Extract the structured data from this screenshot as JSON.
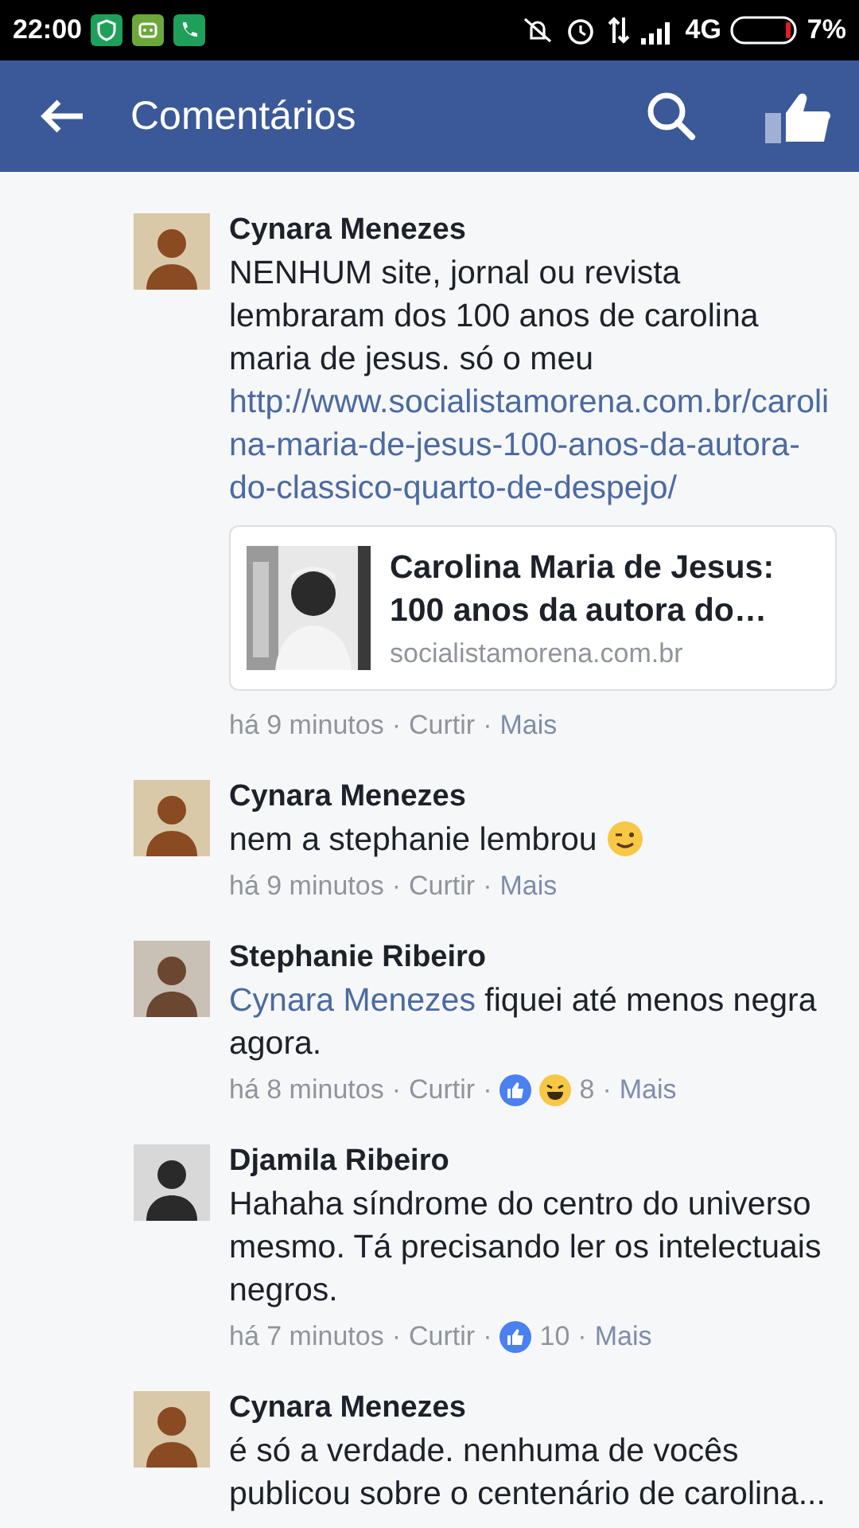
{
  "status_bar": {
    "time": "22:00",
    "network": "4G",
    "battery": "7%"
  },
  "header": {
    "title": "Comentários"
  },
  "comments": [
    {
      "author": "Cynara Menezes",
      "avatar": {
        "kind": "picture"
      },
      "body": [
        {
          "kind": "text",
          "text": "NENHUM site, jornal ou revista lembraram dos 100 anos de carolina maria de jesus. só o meu "
        },
        {
          "kind": "link",
          "text": "http://www.socialistamorena.com.br/carolina-maria-de-jesus-100-anos-da-autora-do-classico-quarto-de-despejo/"
        }
      ],
      "card": {
        "title": "Carolina Maria de Jesus: 100 anos da autora do…",
        "domain": "socialistamorena.com.br"
      },
      "meta": [
        {
          "kind": "time",
          "text": "há 9 minutos"
        },
        {
          "kind": "sep",
          "text": "·"
        },
        {
          "kind": "action",
          "text": "Curtir"
        },
        {
          "kind": "sep",
          "text": "·"
        },
        {
          "kind": "more",
          "text": "Mais"
        }
      ]
    },
    {
      "author": "Cynara Menezes",
      "avatar": {
        "kind": "picture"
      },
      "body": [
        {
          "kind": "text",
          "text": "nem a stephanie lembrou "
        },
        {
          "kind": "wink"
        }
      ],
      "meta": [
        {
          "kind": "time",
          "text": "há 9 minutos"
        },
        {
          "kind": "sep",
          "text": "·"
        },
        {
          "kind": "action",
          "text": "Curtir"
        },
        {
          "kind": "sep",
          "text": "·"
        },
        {
          "kind": "more",
          "text": "Mais"
        }
      ]
    },
    {
      "author": "Stephanie Ribeiro",
      "avatar": {
        "kind": "picture"
      },
      "body": [
        {
          "kind": "mention",
          "text": "Cynara Menezes"
        },
        {
          "kind": "text",
          "text": " fiquei até menos negra agora."
        }
      ],
      "meta": [
        {
          "kind": "time",
          "text": "há 8 minutos"
        },
        {
          "kind": "sep",
          "text": "·"
        },
        {
          "kind": "action",
          "text": "Curtir"
        },
        {
          "kind": "sep",
          "text": "·"
        },
        {
          "kind": "like"
        },
        {
          "kind": "haha"
        },
        {
          "kind": "count",
          "text": "8"
        },
        {
          "kind": "sep",
          "text": "·"
        },
        {
          "kind": "more",
          "text": "Mais"
        }
      ]
    },
    {
      "author": "Djamila Ribeiro",
      "avatar": {
        "kind": "picture"
      },
      "body": [
        {
          "kind": "text",
          "text": "Hahaha síndrome do centro do universo mesmo. Tá precisando ler os intelectuais negros."
        }
      ],
      "meta": [
        {
          "kind": "time",
          "text": "há 7 minutos"
        },
        {
          "kind": "sep",
          "text": "·"
        },
        {
          "kind": "action",
          "text": "Curtir"
        },
        {
          "kind": "sep",
          "text": "·"
        },
        {
          "kind": "like"
        },
        {
          "kind": "count",
          "text": "10"
        },
        {
          "kind": "sep",
          "text": "·"
        },
        {
          "kind": "more",
          "text": "Mais"
        }
      ]
    },
    {
      "author": "Cynara Menezes",
      "avatar": {
        "kind": "picture"
      },
      "body": [
        {
          "kind": "text",
          "text": "é só a verdade. nenhuma de vocês publicou sobre o centenário de carolina..."
        }
      ]
    }
  ]
}
